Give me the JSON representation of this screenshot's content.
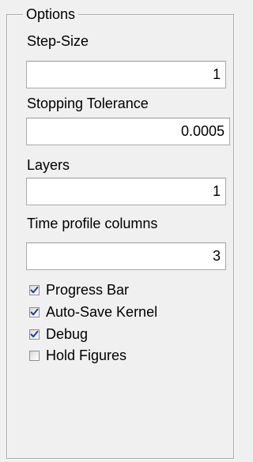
{
  "panel": {
    "title": "Options"
  },
  "fields": {
    "step_size": {
      "label": "Step-Size",
      "value": "1"
    },
    "stopping_tolerance": {
      "label": "Stopping Tolerance",
      "value": "0.0005"
    },
    "layers": {
      "label": "Layers",
      "value": "1"
    },
    "time_profile_columns": {
      "label": "Time profile columns",
      "value": "3"
    }
  },
  "checkboxes": {
    "progress_bar": {
      "label": "Progress Bar",
      "checked": true
    },
    "auto_save_kernel": {
      "label": "Auto-Save Kernel",
      "checked": true
    },
    "debug": {
      "label": "Debug",
      "checked": true
    },
    "hold_figures": {
      "label": "Hold Figures",
      "checked": false
    }
  },
  "colors": {
    "background": "#f0f0f0",
    "check_mark": "#1c3fa8",
    "border": "#a8a8a8"
  },
  "icons": {
    "check": "check-mark-icon"
  }
}
